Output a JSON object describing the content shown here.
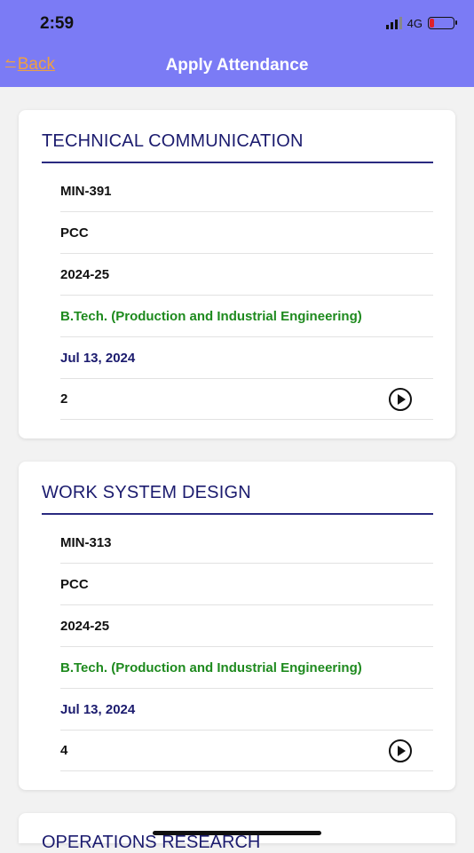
{
  "status_bar": {
    "time": "2:59",
    "network": "4G"
  },
  "header": {
    "back_label": "Back",
    "title": "Apply Attendance"
  },
  "courses": [
    {
      "title": "TECHNICAL COMMUNICATION",
      "code": "MIN-391",
      "category": "PCC",
      "session": "2024-25",
      "program": "B.Tech. (Production and Industrial Engineering)",
      "date": "Jul 13, 2024",
      "count": "2"
    },
    {
      "title": "WORK SYSTEM DESIGN",
      "code": "MIN-313",
      "category": "PCC",
      "session": "2024-25",
      "program": "B.Tech. (Production and Industrial Engineering)",
      "date": "Jul 13, 2024",
      "count": "4"
    },
    {
      "title": "OPERATIONS RESEARCH"
    }
  ],
  "colors": {
    "header_bg": "#7b7bf5",
    "back_link": "#f0a040",
    "title_blue": "#1b1b6e",
    "program_green": "#1e8a1e"
  }
}
